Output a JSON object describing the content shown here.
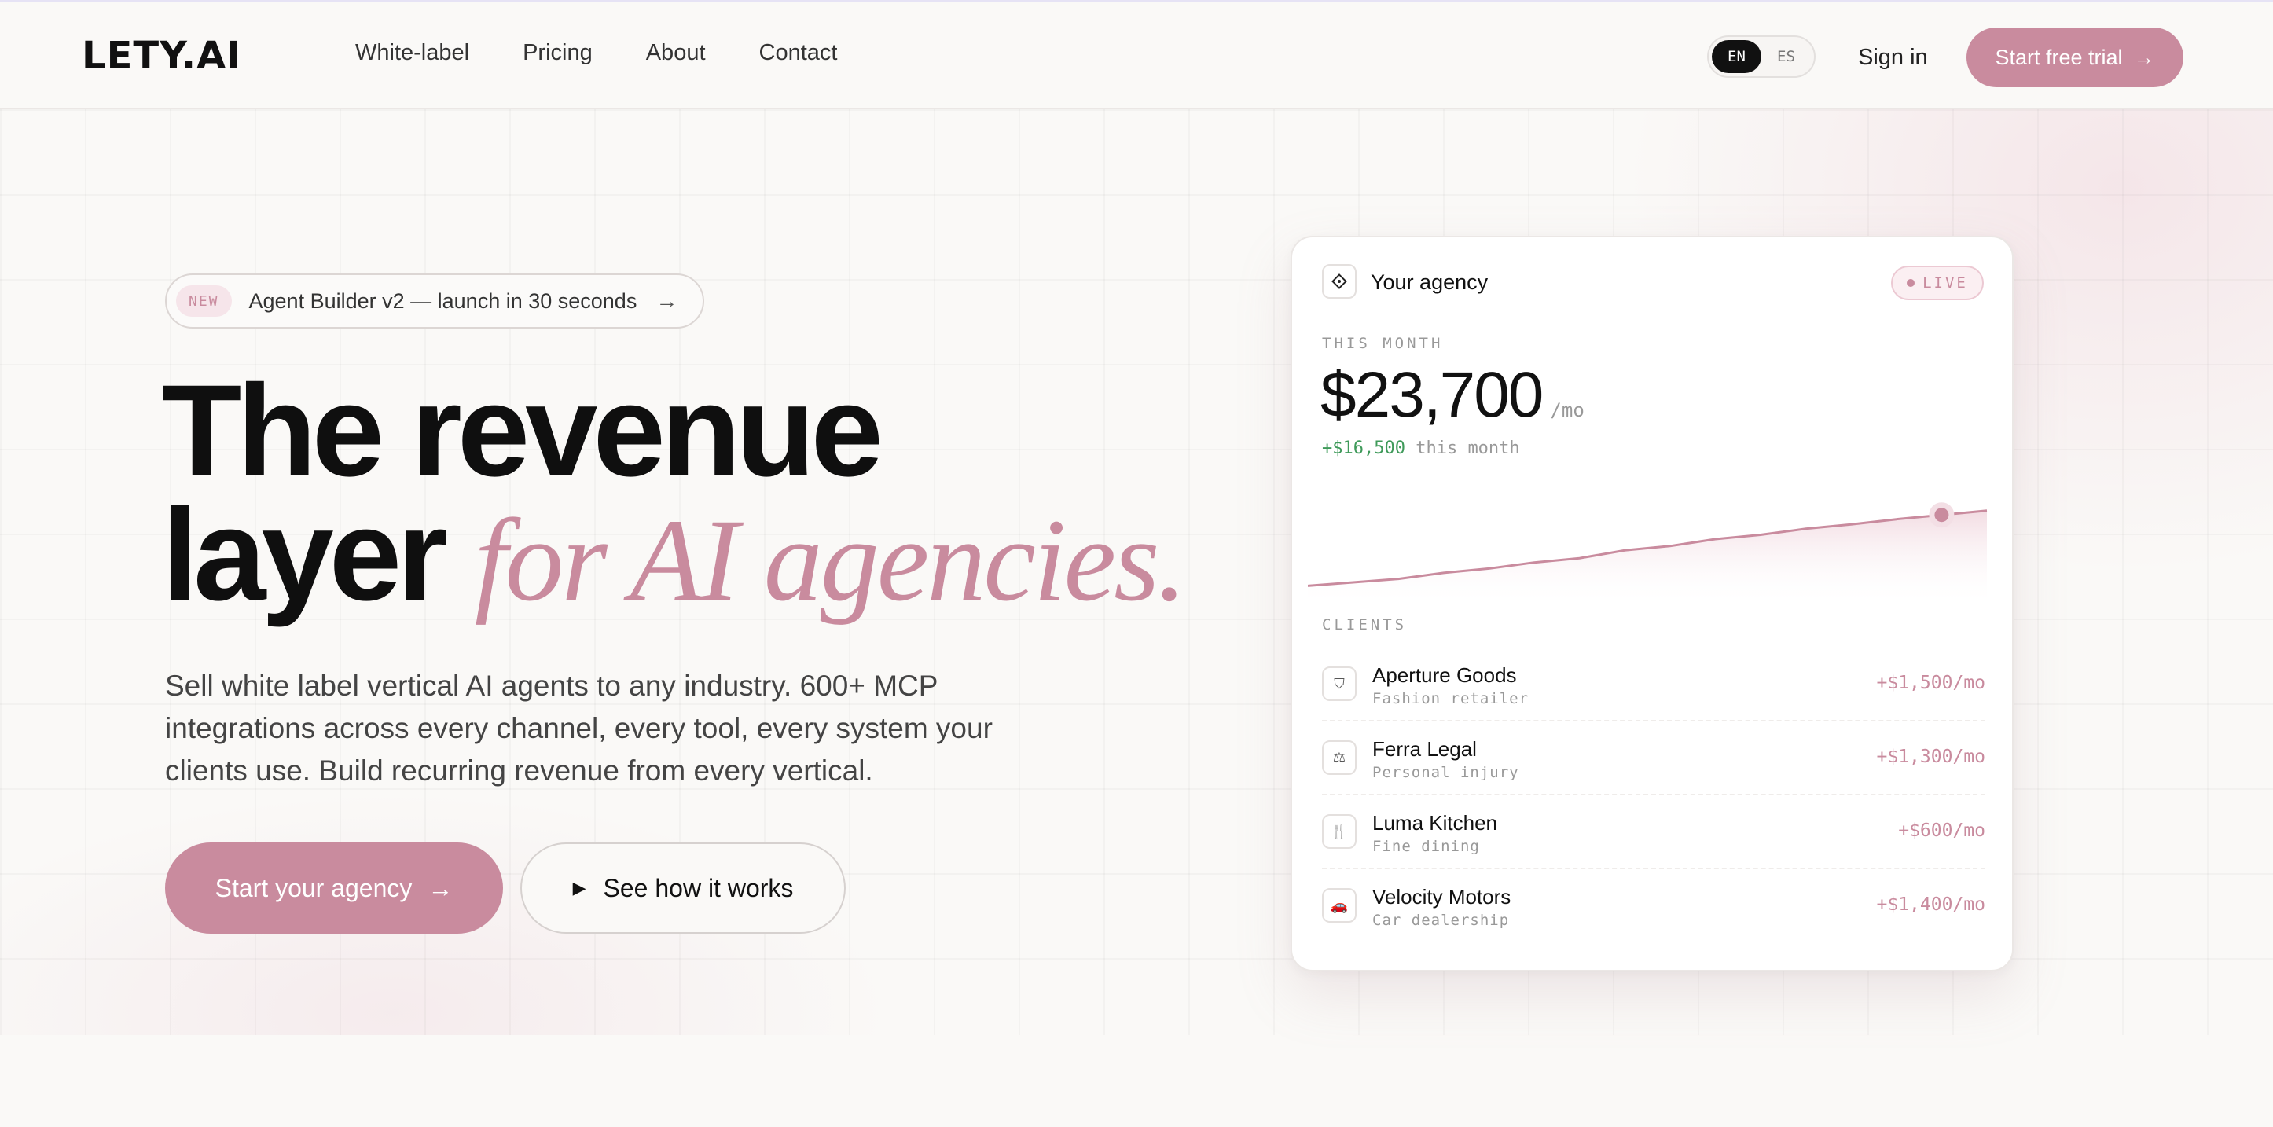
{
  "brand": {
    "logo": "LETY.AI",
    "accent": "#c98b9e"
  },
  "nav": {
    "links": [
      "White-label",
      "Pricing",
      "About",
      "Contact"
    ],
    "lang": [
      "EN",
      "ES"
    ],
    "sign_in": "Sign in",
    "trial": "Start free trial",
    "trial_arrow": "→"
  },
  "hero": {
    "badge_new": "NEW",
    "badge_text": "Agent Builder v2 — launch in 30 seconds",
    "badge_arrow": "→",
    "title_line1": "The revenue",
    "title_line2": "layer",
    "title_accent": "for AI agencies.",
    "subtitle": "Sell white label vertical AI agents to any industry. 600+ MCP integrations across every channel, every tool, every system your clients use. Build recurring revenue from every vertical.",
    "cta_primary": "Start your agency",
    "cta_primary_arrow": "→",
    "cta_secondary": "See how it works",
    "cta_play": "▶"
  },
  "card": {
    "title": "Your agency",
    "live": "LIVE",
    "month_label": "THIS MONTH",
    "amount": "$23,700",
    "amount_unit": "/mo",
    "delta_value": "+$16,500",
    "delta_text": " this month",
    "sparkline": [
      0.06,
      0.1,
      0.14,
      0.21,
      0.26,
      0.33,
      0.38,
      0.47,
      0.52,
      0.6,
      0.65,
      0.72,
      0.77,
      0.83,
      0.88,
      0.93
    ],
    "clients_label": "CLIENTS",
    "clients": [
      {
        "icon": "shirt-icon",
        "glyph": "⛉",
        "name": "Aperture Goods",
        "sub": "Fashion retailer",
        "amount": "+$1,500/mo"
      },
      {
        "icon": "scale-icon",
        "glyph": "⚖",
        "name": "Ferra Legal",
        "sub": "Personal injury",
        "amount": "+$1,300/mo"
      },
      {
        "icon": "utensils-icon",
        "glyph": "🍴",
        "name": "Luma Kitchen",
        "sub": "Fine dining",
        "amount": "+$600/mo"
      },
      {
        "icon": "car-icon",
        "glyph": "🚗",
        "name": "Velocity Motors",
        "sub": "Car dealership",
        "amount": "+$1,400/mo"
      }
    ]
  }
}
